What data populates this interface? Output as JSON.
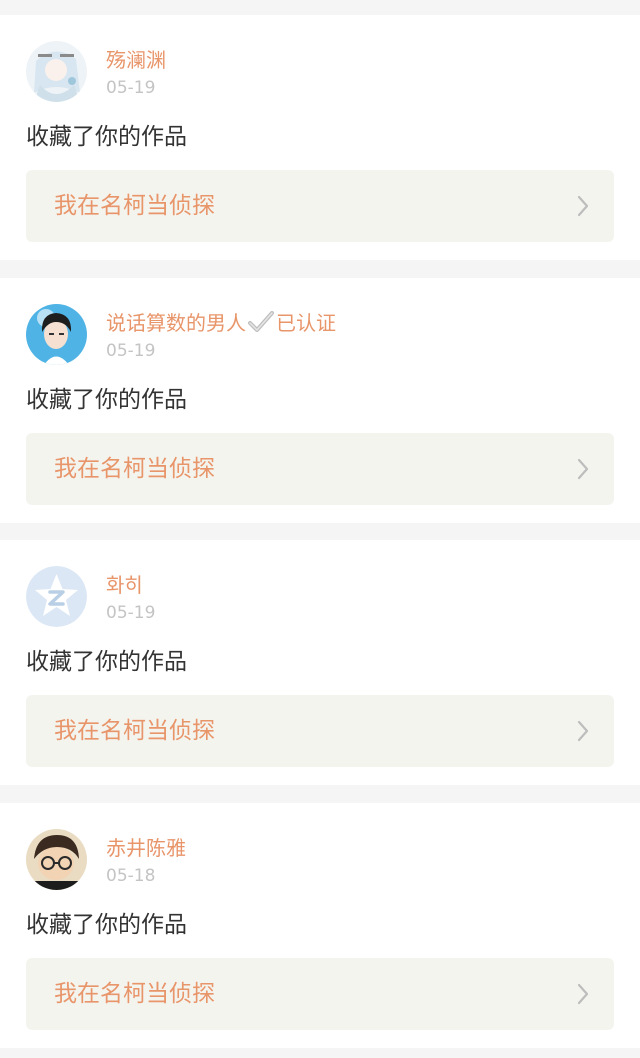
{
  "notifications": [
    {
      "user": {
        "name": "殇澜渊",
        "avatar": "anime-girl-avatar"
      },
      "date": "05-19",
      "action": "收藏了你的作品",
      "work": {
        "title": "我在名柯当侦探",
        "icon": "chevron-right-icon"
      }
    },
    {
      "user": {
        "name": "说话算数的男人",
        "verified_label": "已认证",
        "verified_icon": "checkmark-icon",
        "avatar": "anime-boy-avatar"
      },
      "date": "05-19",
      "action": "收藏了你的作品",
      "work": {
        "title": "我在名柯当侦探",
        "icon": "chevron-right-icon"
      }
    },
    {
      "user": {
        "name": "화히",
        "avatar": "default-star-avatar"
      },
      "date": "05-19",
      "action": "收藏了你的作品",
      "work": {
        "title": "我在名柯当侦探",
        "icon": "chevron-right-icon"
      }
    },
    {
      "user": {
        "name": "赤井陈雅",
        "avatar": "conan-avatar"
      },
      "date": "05-18",
      "action": "收藏了你的作品",
      "work": {
        "title": "我在名柯当侦探",
        "icon": "chevron-right-icon"
      }
    }
  ],
  "colors": {
    "accent": "#e8956a",
    "timestamp": "#c4c4c4",
    "body_text": "#333333",
    "work_background": "#f4f4ef",
    "page_background": "#f5f5f5"
  }
}
